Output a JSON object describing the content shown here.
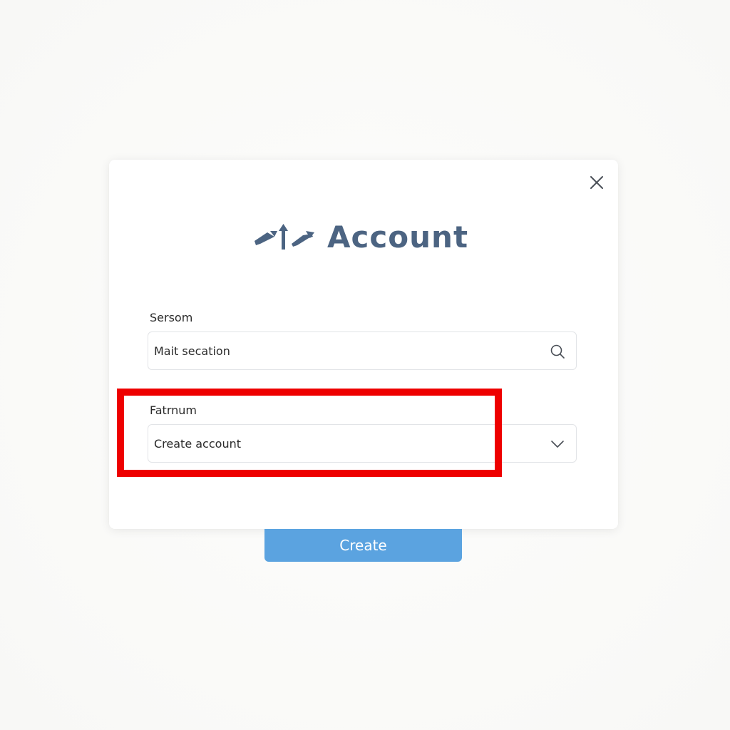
{
  "dialog": {
    "title": "Account",
    "logo_icon": "arrows-logo-icon",
    "close_icon": "close-icon"
  },
  "fields": [
    {
      "label": "Sersom",
      "value": "Mait secation",
      "icon": "search-icon"
    },
    {
      "label": "Fatrnum",
      "value": "Create account",
      "icon": "chevron-down-icon"
    }
  ],
  "actions": {
    "create_label": "Create"
  },
  "colors": {
    "title": "#4c6482",
    "primary_button": "#5ba3e0",
    "highlight": "#ee0000"
  }
}
